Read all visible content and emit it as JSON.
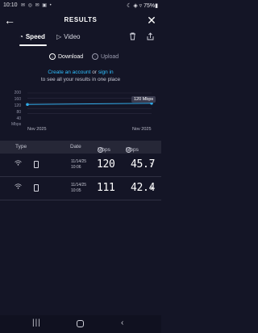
{
  "status_bar": {
    "time": "10:10",
    "notification_icons": "✉ ◎ ✉ ▣ •",
    "right": "☾ ◈ ▿ 75%▮"
  },
  "header": {
    "title": "RESULTS",
    "back_icon": "arrow-left-icon",
    "close_icon": "close-icon"
  },
  "tabs": [
    {
      "label": "Speed",
      "active": true
    },
    {
      "label": "Video",
      "active": false
    }
  ],
  "sub_tabs": [
    {
      "label": "Download",
      "active": true
    },
    {
      "label": "Upload",
      "active": false
    }
  ],
  "account": {
    "create_link": "Create an account",
    "or": " or ",
    "signin_link": "sign in",
    "subtitle": "to see all your results in one place"
  },
  "chart_data": {
    "type": "line",
    "y_ticks": [
      "200",
      "160",
      "120",
      "80",
      "40"
    ],
    "ylabel": "Mbps",
    "x_ticks": [
      "Nov 2025",
      "Nov 2025"
    ],
    "ylim": [
      0,
      200
    ],
    "series": [
      {
        "values": [
          111,
          120
        ]
      }
    ],
    "value_label": "120 Mbps",
    "accent": "#2fa9e6"
  },
  "table": {
    "headers": {
      "type": "Type",
      "date": "Date",
      "download": "Mbps",
      "upload": "Mbps"
    },
    "rows": [
      {
        "date": "11/14/25",
        "time": "10:06",
        "download": "120",
        "upload": "45.7"
      },
      {
        "date": "11/14/25",
        "time": "10:05",
        "download": "111",
        "upload": "42.4"
      }
    ]
  },
  "colors": {
    "background": "#141526",
    "accent": "#2fc0ff",
    "table_header": "#262737"
  }
}
